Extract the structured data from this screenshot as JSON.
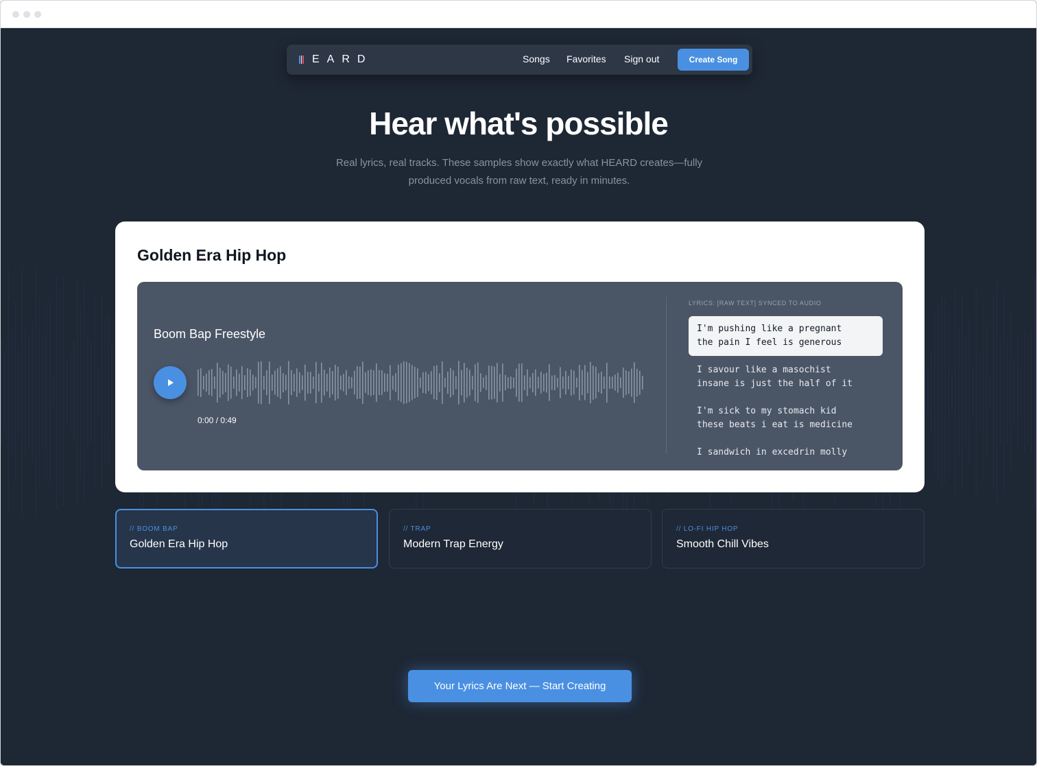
{
  "brand": {
    "name": "HEARD",
    "mark_colors": [
      "#4a90e2",
      "#ffffff",
      "#e04f5f"
    ]
  },
  "nav": {
    "links": [
      "Songs",
      "Favorites",
      "Sign out"
    ],
    "create_label": "Create Song"
  },
  "hero": {
    "title": "Hear what's possible",
    "subtitle": "Real lyrics, real tracks. These samples show exactly what HEARD creates—fully produced vocals from raw text, ready in minutes."
  },
  "sample": {
    "title": "Golden Era Hip Hop",
    "track_title": "Boom Bap Freestyle",
    "time": "0:00 / 0:49",
    "play_icon": "play-icon",
    "lyrics_heading": "LYRICS: [RAW TEXT] SYNCED TO AUDIO",
    "lyrics": [
      {
        "line1": "I'm pushing like a pregnant",
        "line2": "the pain I feel is generous",
        "active": true
      },
      {
        "line1": "I savour like a masochist",
        "line2": "insane is just the half of it",
        "active": false
      },
      {
        "line1": "I'm sick to my stomach kid",
        "line2": "these beats i eat is medicine",
        "active": false
      },
      {
        "line1": "I sandwich in excedrin molly",
        "line2": "",
        "active": false
      }
    ]
  },
  "genres": [
    {
      "tag": "// BOOM BAP",
      "name": "Golden Era Hip Hop",
      "selected": true
    },
    {
      "tag": "// TRAP",
      "name": "Modern Trap Energy",
      "selected": false
    },
    {
      "tag": "// LO-FI HIP HOP",
      "name": "Smooth Chill Vibes",
      "selected": false
    }
  ],
  "cta_label": "Your Lyrics Are Next — Start Creating",
  "colors": {
    "accent": "#4a90e2",
    "background": "#1e2734",
    "card": "#ffffff",
    "player": "#4a5566"
  }
}
